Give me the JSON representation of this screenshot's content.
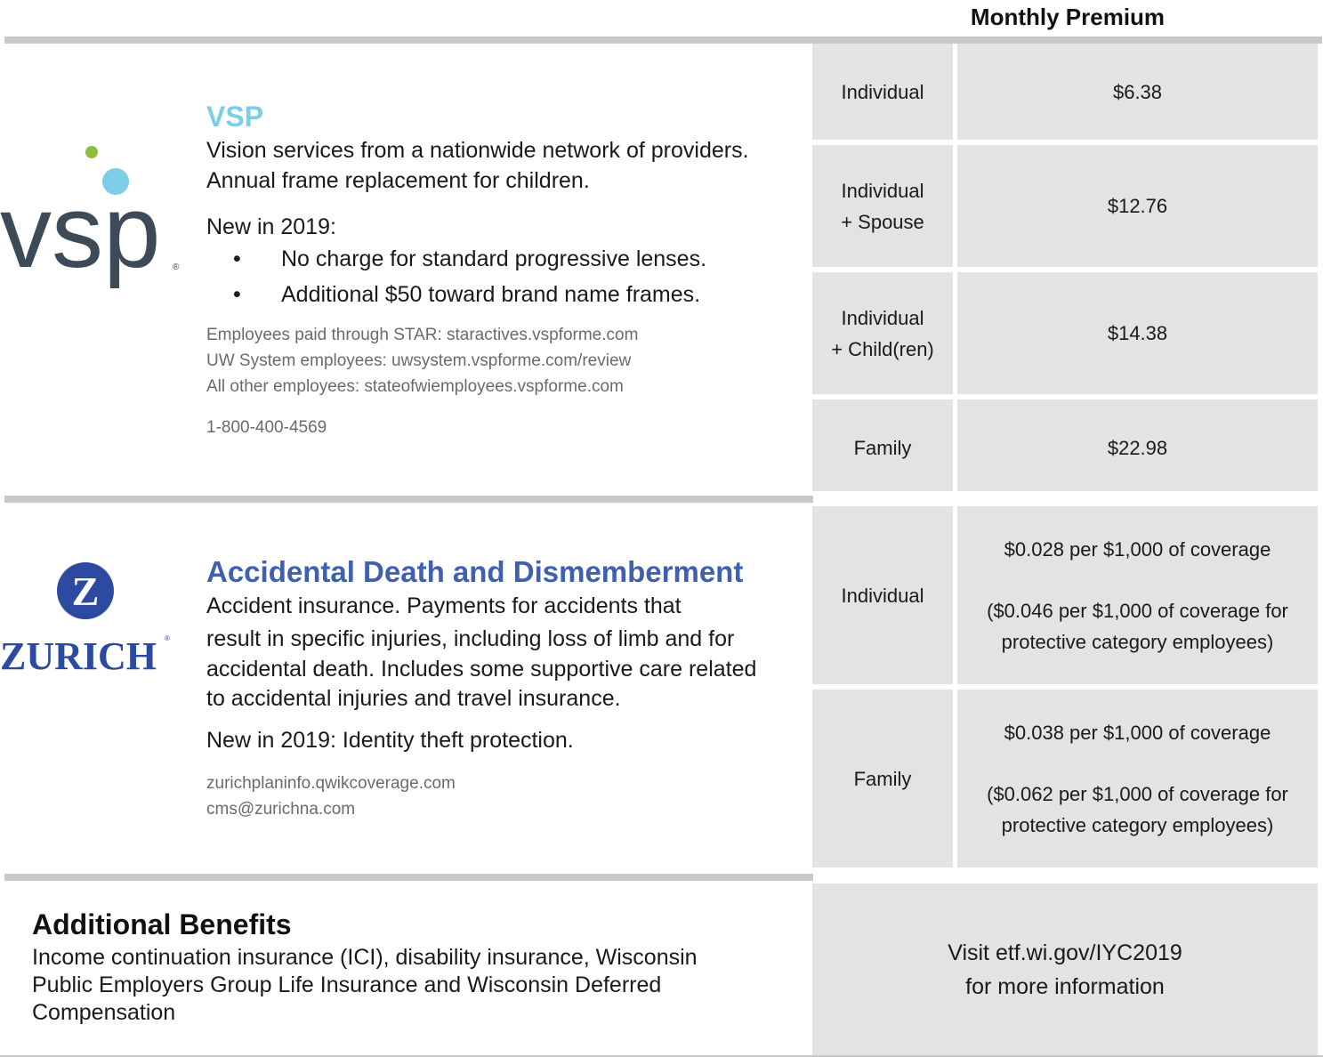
{
  "header": {
    "monthly_premium_label": "Monthly Premium"
  },
  "vsp": {
    "logo_text": "vsp",
    "title": "VSP",
    "desc_line1": "Vision services from a nationwide network of providers.",
    "desc_line2": "Annual frame replacement for children.",
    "new_label": "New in 2019:",
    "bullets": [
      "No charge for standard progressive lenses.",
      "Additional $50 toward brand name frames."
    ],
    "links": [
      "Employees paid through STAR: staractives.vspforme.com",
      "UW System employees: uwsystem.vspforme.com/review",
      "All other employees: stateofwiemployees.vspforme.com"
    ],
    "phone": "1-800-400-4569",
    "premiums": [
      {
        "tier_line1": "Individual",
        "tier_line2": "",
        "price": "$6.38"
      },
      {
        "tier_line1": "Individual",
        "tier_line2": "+ Spouse",
        "price": "$12.76"
      },
      {
        "tier_line1": "Individual",
        "tier_line2": "+ Child(ren)",
        "price": "$14.38"
      },
      {
        "tier_line1": "Family",
        "tier_line2": "",
        "price": "$22.98"
      }
    ]
  },
  "add": {
    "logo_text": "ZURICH",
    "logo_symbol": "Z",
    "title": "Accidental Death and Dismemberment",
    "desc_lines": [
      "Accident insurance. Payments for accidents that",
      "result in specific injuries, including loss of limb and for",
      "accidental death. Includes some supportive care related",
      "to accidental injuries and travel insurance."
    ],
    "new_text": "New in 2019: Identity theft protection.",
    "links": [
      "zurichplaninfo.qwikcoverage.com",
      "cms@zurichna.com"
    ],
    "premiums": [
      {
        "tier": "Individual",
        "rate": "$0.028 per $1,000 of coverage",
        "protective_line1": "($0.046 per $1,000 of coverage for",
        "protective_line2": "protective category employees)"
      },
      {
        "tier": "Family",
        "rate": "$0.038 per $1,000 of coverage",
        "protective_line1": "($0.062 per $1,000 of coverage for",
        "protective_line2": "protective category employees)"
      }
    ]
  },
  "additional": {
    "title": "Additional Benefits",
    "desc_lines": [
      "Income continuation insurance (ICI), disability insurance, Wisconsin",
      "Public Employers Group Life Insurance and Wisconsin Deferred",
      "Compensation"
    ],
    "visit_line1": "Visit etf.wi.gov/IYC2019",
    "visit_line2": "for more information"
  },
  "colors": {
    "vsp_title": "#7ccde6",
    "add_title": "#3f5faf",
    "zurich_blue": "#2b4aa0",
    "vsp_logo_dark": "#3d4a57",
    "vsp_dot_green": "#8fbe3a",
    "vsp_dot_blue": "#7ccde6",
    "cell_bg": "#e3e3e3",
    "rule": "#c8c8c8"
  }
}
